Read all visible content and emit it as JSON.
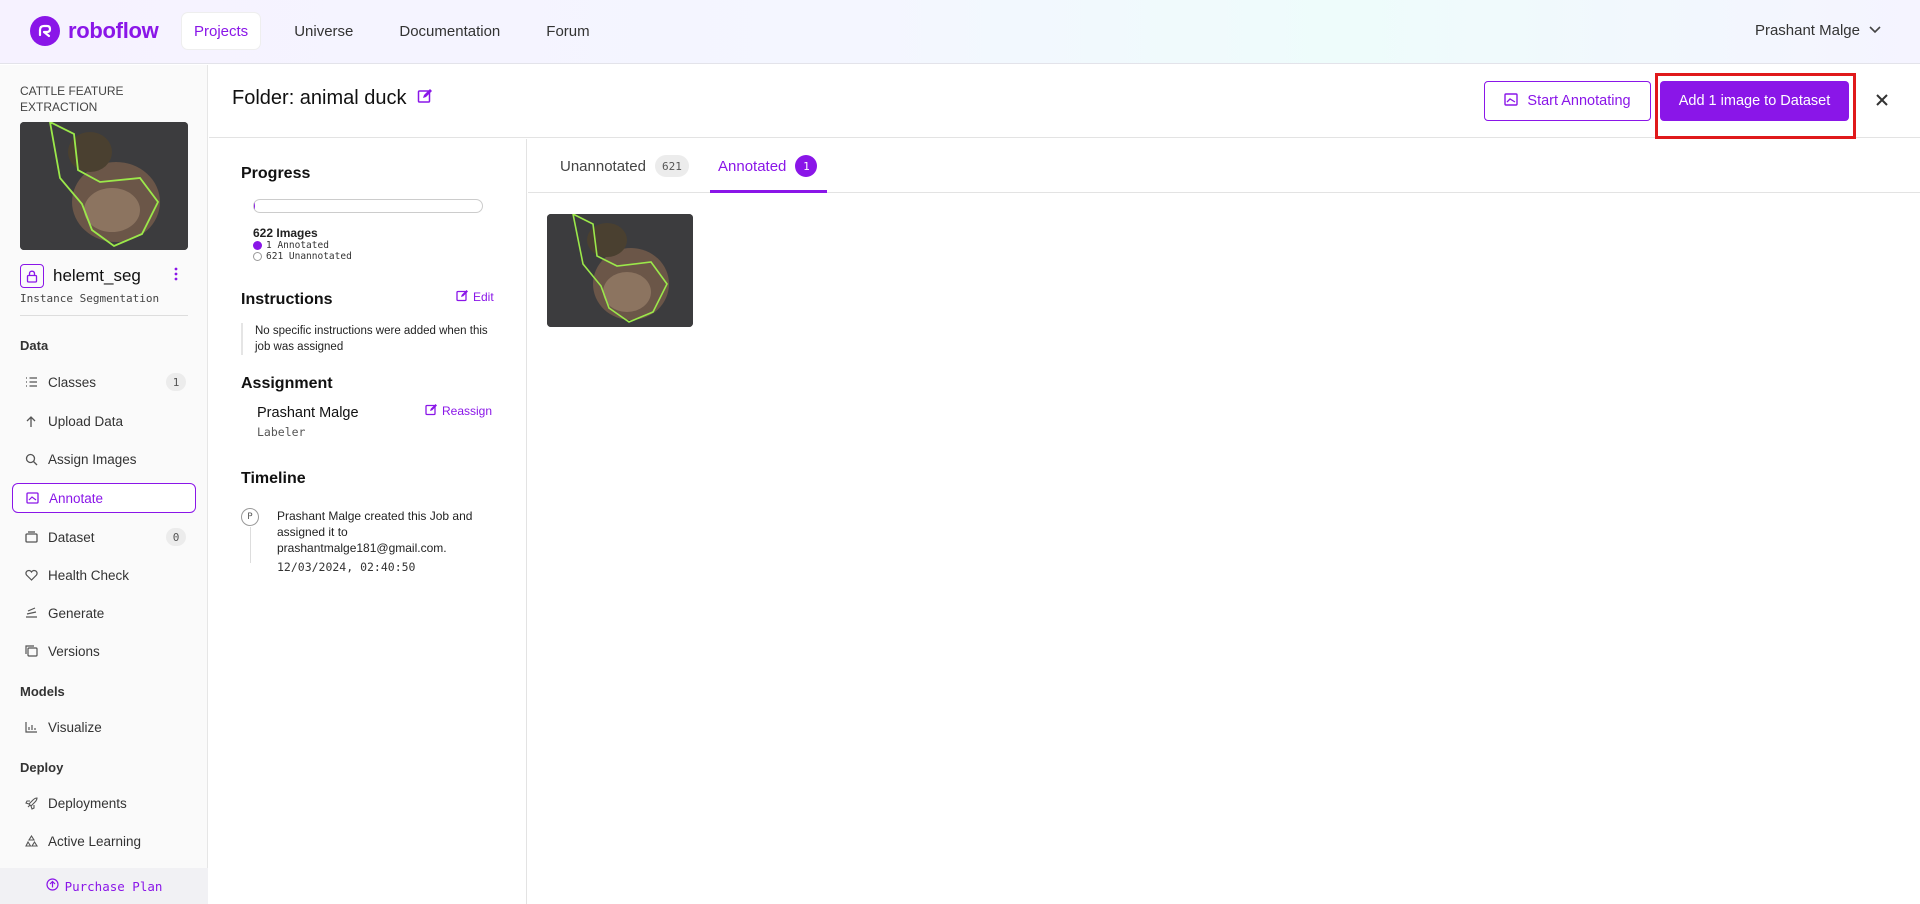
{
  "nav": {
    "brand": "roboflow",
    "links": [
      "Projects",
      "Universe",
      "Documentation",
      "Forum"
    ],
    "active_link": "Projects",
    "user_name": "Prashant Malge"
  },
  "sidebar": {
    "project_name": "CATTLE FEATURE EXTRACTION",
    "project_title": "helemt_seg",
    "project_type": "Instance Segmentation",
    "data_heading": "Data",
    "models_heading": "Models",
    "deploy_heading": "Deploy",
    "items": [
      {
        "label": "Classes",
        "icon": "list-icon",
        "count": "1"
      },
      {
        "label": "Upload Data",
        "icon": "upload-icon"
      },
      {
        "label": "Assign Images",
        "icon": "search-icon"
      },
      {
        "label": "Annotate",
        "icon": "annotate-icon",
        "active": true
      },
      {
        "label": "Dataset",
        "icon": "dataset-icon",
        "count": "0"
      },
      {
        "label": "Health Check",
        "icon": "heart-icon"
      },
      {
        "label": "Generate",
        "icon": "generate-icon"
      },
      {
        "label": "Versions",
        "icon": "versions-icon"
      },
      {
        "label": "Visualize",
        "icon": "chart-icon"
      },
      {
        "label": "Deployments",
        "icon": "rocket-icon"
      },
      {
        "label": "Active Learning",
        "icon": "recycle-icon"
      }
    ],
    "purchase_label": "Purchase Plan"
  },
  "header": {
    "folder_title": "Folder: animal duck",
    "start_annotating_label": "Start Annotating",
    "add_to_dataset_label": "Add 1 image to Dataset"
  },
  "progress": {
    "heading": "Progress",
    "annotated_fraction": 0.0016,
    "image_count": "622 Images",
    "annotated_label": "1 Annotated",
    "unannotated_label": "621 Unannotated",
    "annotated_color": "#8a16e8"
  },
  "instructions": {
    "heading": "Instructions",
    "edit_label": "Edit",
    "text": "No specific instructions were added when this job was assigned"
  },
  "assignment": {
    "heading": "Assignment",
    "reassign_label": "Reassign",
    "assignee": "Prashant Malge",
    "role": "Labeler"
  },
  "timeline": {
    "heading": "Timeline",
    "avatar_letter": "P",
    "entry_text": "Prashant Malge created this Job and assigned it to prashantmalge181@gmail.com.",
    "entry_date": "12/03/2024, 02:40:50"
  },
  "tabs": {
    "unannotated_label": "Unannotated",
    "unannotated_count": "621",
    "annotated_label": "Annotated",
    "annotated_count": "1"
  }
}
